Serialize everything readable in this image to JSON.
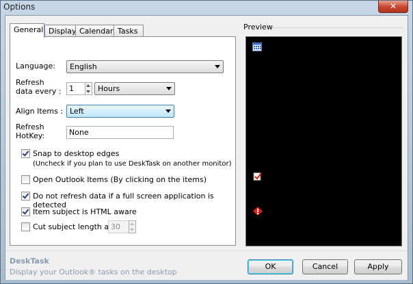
{
  "window": {
    "title": "Options",
    "close_glyph": "✕"
  },
  "tabs": [
    {
      "label": "General",
      "active": true
    },
    {
      "label": "Display",
      "active": false
    },
    {
      "label": "Calendar",
      "active": false
    },
    {
      "label": "Tasks",
      "active": false
    }
  ],
  "general": {
    "language_label": "Language:",
    "language_value": "English",
    "refresh_label_line1": "Refresh",
    "refresh_label_line2": "data every :",
    "refresh_amount": "1",
    "refresh_unit": "Hours",
    "align_label": "Align Items :",
    "align_value": "Left",
    "hotkey_label_line1": "Refresh",
    "hotkey_label_line2": "HotKey:",
    "hotkey_value": "None",
    "snap_label": "Snap to desktop edges",
    "snap_note": "(Uncheck if you plan to use DeskTask on another monitor)",
    "snap_checked": true,
    "open_outlook_label": "Open Outlook Items (By clicking on the items)",
    "open_outlook_checked": false,
    "no_refresh_label": "Do not refresh data if a full screen application is detected",
    "no_refresh_checked": true,
    "html_aware_label": "Item subject is HTML aware",
    "html_aware_checked": true,
    "cut_subject_label": "Cut subject length at:",
    "cut_subject_checked": false,
    "cut_subject_value": "30"
  },
  "preview": {
    "label": "Preview",
    "icons": [
      "calendar-icon",
      "task-check-icon",
      "priority-alert-icon"
    ],
    "background": "#000000"
  },
  "footer": {
    "app_name": "DeskTask",
    "app_description": "Display your Outlook® tasks on the desktop",
    "ok_label": "OK",
    "cancel_label": "Cancel",
    "apply_label": "Apply"
  }
}
